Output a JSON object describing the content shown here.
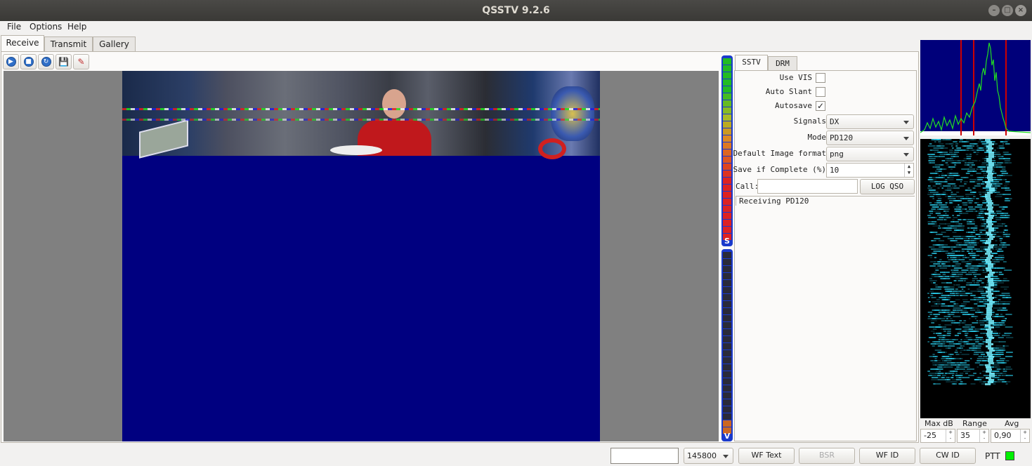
{
  "window": {
    "title": "QSSTV 9.2.6",
    "min_icon": "–",
    "max_icon": "□",
    "close_icon": "×"
  },
  "menu": {
    "file": "File",
    "options": "Options",
    "help": "Help"
  },
  "tabs": {
    "receive": "Receive",
    "transmit": "Transmit",
    "gallery": "Gallery"
  },
  "toolbar": {
    "start_glyph": "▶",
    "stop_glyph": "■",
    "resync_glyph": "↻",
    "save_glyph": "💾",
    "erase_glyph": "✎"
  },
  "meters": {
    "s_label": "S",
    "v_label": "V"
  },
  "sstv_panel": {
    "tab_sstv": "SSTV",
    "tab_drm": "DRM",
    "use_vis_label": "Use VIS",
    "use_vis_checked": "",
    "auto_slant_label": "Auto Slant",
    "auto_slant_checked": "",
    "autosave_label": "Autosave",
    "autosave_checked": "✓",
    "signals_label": "Signals",
    "signals_value": "DX",
    "mode_label": "Mode",
    "mode_value": "PD120",
    "image_format_label": "Default Image format",
    "image_format_value": "png",
    "save_complete_label": "Save if Complete (%)",
    "save_complete_value": "10",
    "call_label": "Call:",
    "call_value": "",
    "log_qso_label": "LOG QSO",
    "status_text": "Receiving PD120"
  },
  "waterfall_controls": {
    "max_db_label": "Max dB",
    "range_label": "Range",
    "avg_label": "Avg",
    "max_db_value": "-25",
    "range_value": "35",
    "avg_value": "0,90"
  },
  "bottom": {
    "status_field": "",
    "frequency": "145800",
    "wf_text": "WF Text",
    "bsr": "BSR",
    "wf_id": "WF ID",
    "cw_id": "CW ID",
    "ptt": "PTT",
    "ptt_color": "#00f000"
  },
  "colors": {
    "image_background": "#000080",
    "meter_frame": "#1a3acc",
    "spectrum_background": "#00007a",
    "spectrum_trace": "#22dd22",
    "marker": "#cc0000"
  }
}
